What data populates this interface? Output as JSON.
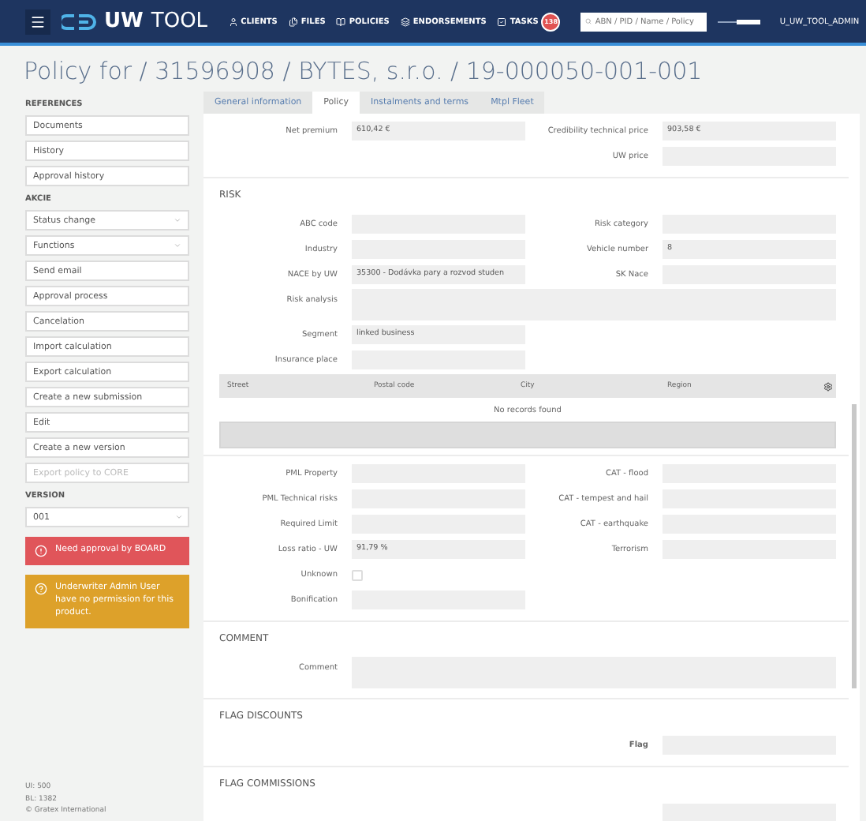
{
  "header": {
    "brand": [
      "UW",
      "TOOL"
    ],
    "nav": [
      {
        "label": "CLIENTS"
      },
      {
        "label": "FILES"
      },
      {
        "label": "POLICIES"
      },
      {
        "label": "ENDORSEMENTS"
      },
      {
        "label": "TASKS",
        "badge": "138"
      }
    ],
    "search": {
      "placeholder": "ABN / PID / Name / Policy"
    },
    "user": "U_UW_TOOL_ADMIN"
  },
  "title": "Policy for / 31596908 / BYTES, s.r.o. / 19-000050-001-001",
  "sidebar": {
    "groups": [
      {
        "label": "REFERENCES",
        "items": [
          {
            "label": "Documents",
            "kind": "button",
            "disabled": false
          },
          {
            "label": "History",
            "kind": "button",
            "disabled": false
          },
          {
            "label": "Approval history",
            "kind": "button",
            "disabled": false
          }
        ]
      },
      {
        "label": "AKCIE",
        "items": [
          {
            "label": "Status change",
            "kind": "dropdown",
            "disabled": false
          },
          {
            "label": "Functions",
            "kind": "dropdown",
            "disabled": false
          },
          {
            "label": "Send email",
            "kind": "button",
            "disabled": false
          },
          {
            "label": "Approval process",
            "kind": "button",
            "disabled": false
          },
          {
            "label": "Cancelation",
            "kind": "button",
            "disabled": false
          },
          {
            "label": "Import calculation",
            "kind": "button",
            "disabled": false
          },
          {
            "label": "Export calculation",
            "kind": "button",
            "disabled": false
          },
          {
            "label": "Create a new submission",
            "kind": "button",
            "disabled": false
          },
          {
            "label": "Edit",
            "kind": "button",
            "disabled": false
          },
          {
            "label": "Create a new version",
            "kind": "button",
            "disabled": false
          },
          {
            "label": "Export policy to CORE",
            "kind": "button",
            "disabled": true
          }
        ]
      }
    ],
    "version": {
      "label": "VERSION",
      "value": "001"
    },
    "alerts": [
      {
        "kind": "danger",
        "text": "Need approval by BOARD"
      },
      {
        "kind": "warning",
        "text": "Underwriter Admin User have no permission for this product."
      }
    ],
    "footer": [
      "UI: 500",
      "BL: 1382",
      "© Gratex International"
    ]
  },
  "tabs": [
    {
      "label": "General information",
      "selected": false
    },
    {
      "label": "Policy",
      "selected": true
    },
    {
      "label": "Instalments and terms",
      "selected": false
    },
    {
      "label": "Mtpl Fleet",
      "selected": false
    }
  ],
  "sections": [
    {
      "rows": [
        {
          "left": {
            "label": "Net premium",
            "value": "610,42 €",
            "kind": "input"
          },
          "right": {
            "label": "Credibility technical price",
            "value": "903,58 €",
            "kind": "input"
          }
        },
        {
          "right": {
            "label": "UW price",
            "kind": "input"
          }
        }
      ]
    },
    {
      "title": "RISK",
      "rows": [
        {
          "left": {
            "label": "ABC code",
            "kind": "input"
          },
          "right": {
            "label": "Risk category",
            "kind": "input"
          }
        },
        {
          "left": {
            "label": "Industry",
            "kind": "input"
          },
          "right": {
            "label": "Vehicle number",
            "value": "8",
            "kind": "input"
          }
        },
        {
          "left": {
            "label": "NACE by UW",
            "value": "35300 - Dodávka pary a rozvod studen",
            "kind": "input"
          },
          "right": {
            "label": "SK Nace",
            "kind": "input"
          }
        },
        {
          "wide": {
            "label": "Risk analysis",
            "kind": "textarea"
          }
        },
        {
          "left": {
            "label": "Segment",
            "value": "linked business",
            "kind": "input"
          }
        },
        {
          "left": {
            "label": "Insurance place",
            "kind": "input"
          }
        }
      ],
      "table": {
        "columns": [
          "Street",
          "Postal code",
          "City",
          "Region"
        ],
        "empty": "No records found"
      }
    },
    {
      "rows": [
        {
          "left": {
            "label": "PML Property",
            "kind": "input"
          },
          "right": {
            "label": "CAT - flood",
            "kind": "input"
          }
        },
        {
          "left": {
            "label": "PML Technical risks",
            "kind": "input"
          },
          "right": {
            "label": "CAT - tempest and hail",
            "kind": "input"
          }
        },
        {
          "left": {
            "label": "Required Limit",
            "kind": "input"
          },
          "right": {
            "label": "CAT - earthquake",
            "kind": "input"
          }
        },
        {
          "left": {
            "label": "Loss ratio - UW",
            "value": "91,79 %",
            "kind": "input"
          },
          "right": {
            "label": "Terrorism",
            "kind": "input"
          }
        },
        {
          "left": {
            "label": "Unknown",
            "kind": "checkbox",
            "checked": false
          }
        },
        {
          "left": {
            "label": "Bonification",
            "kind": "input"
          }
        }
      ]
    },
    {
      "title": "COMMENT",
      "rows": [
        {
          "wide": {
            "label": "Comment",
            "kind": "textarea"
          }
        }
      ]
    },
    {
      "title": "FLAG DISCOUNTS",
      "rows": [
        {
          "right": {
            "label": "Flag",
            "kind": "input",
            "bold": true
          }
        }
      ]
    },
    {
      "title": "FLAG COMMISSIONS",
      "rows": [
        {
          "right": {
            "kind": "input"
          }
        }
      ]
    }
  ]
}
